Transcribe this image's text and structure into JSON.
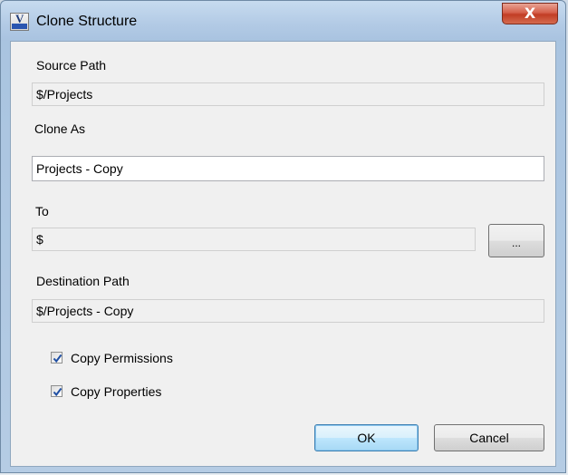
{
  "window": {
    "title": "Clone Structure",
    "close_glyph": "X"
  },
  "form": {
    "source_path": {
      "label": "Source Path",
      "value": "$/Projects"
    },
    "clone_as": {
      "label": "Clone As",
      "value": "Projects - Copy"
    },
    "to": {
      "label": "To",
      "value": "$",
      "browse_label": "..."
    },
    "destination_path": {
      "label": "Destination Path",
      "value": "$/Projects - Copy"
    },
    "checkboxes": [
      {
        "label": "Copy Permissions",
        "checked": true
      },
      {
        "label": "Copy Properties",
        "checked": true
      }
    ]
  },
  "buttons": {
    "ok": "OK",
    "cancel": "Cancel"
  },
  "colors": {
    "title_bar": "#b2cae5",
    "client_bg": "#f0f0f0",
    "close_button": "#c23d24",
    "check_mark": "#1f4fa3"
  }
}
